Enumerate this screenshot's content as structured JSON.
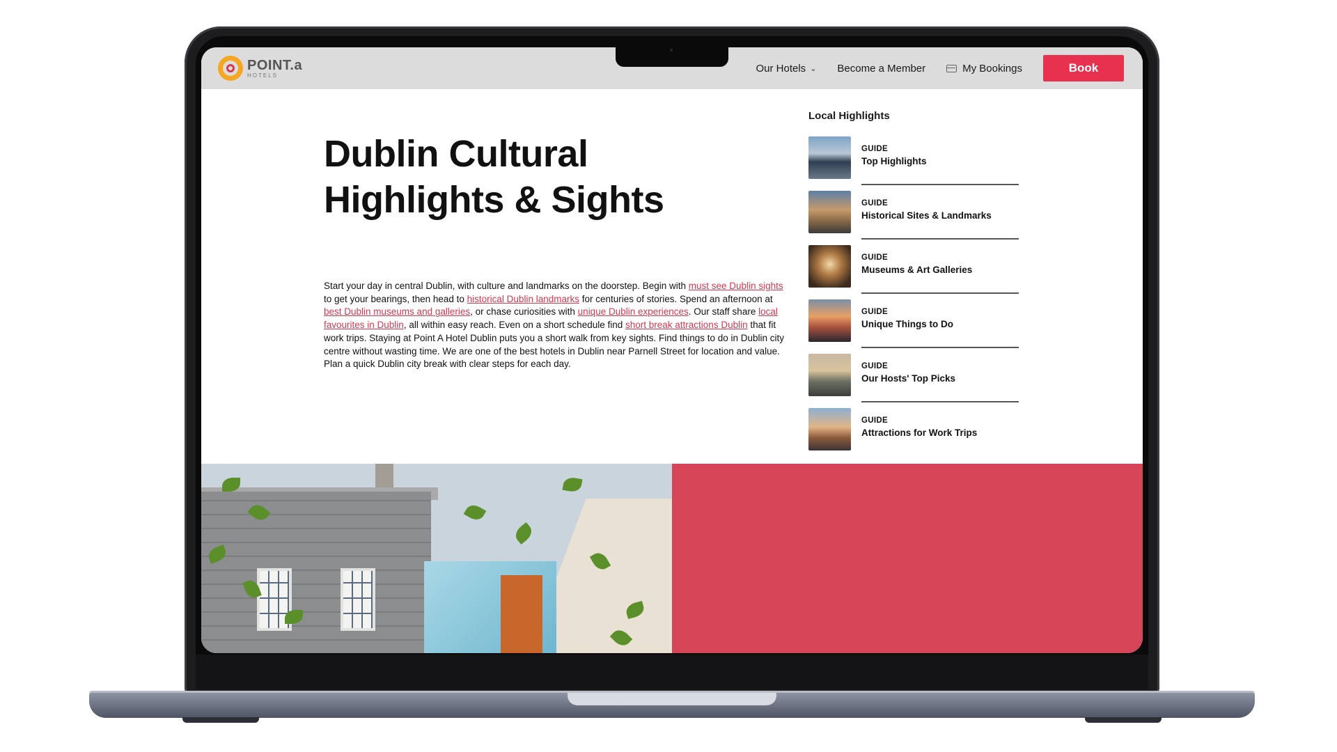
{
  "header": {
    "logo_name": "POINT.a",
    "logo_sub": "HOTELS",
    "nav": {
      "our_hotels": "Our Hotels",
      "become_member": "Become a Member",
      "my_bookings": "My Bookings",
      "book": "Book"
    }
  },
  "main": {
    "headline_line1": "Dublin Cultural",
    "headline_line2": "Highlights & Sights",
    "intro": {
      "p1": "Start your day in central Dublin, with culture and landmarks on the doorstep. Begin with ",
      "link1": "must see Dublin sights",
      "p2": " to get your bearings, then head to ",
      "link2": "historical Dublin landmarks",
      "p3": " for centuries of stories. Spend an afternoon at ",
      "link3": "best Dublin museums and galleries",
      "p4": ", or chase curiosities with ",
      "link4": "unique Dublin experiences",
      "p5": ". Our staff share ",
      "link5": "local favourites in Dublin",
      "p6": ", all within easy reach. Even on a short schedule find ",
      "link6": "short break attractions Dublin",
      "p7": " that fit work trips. Staying at Point A Hotel Dublin puts you a short walk from key sights. Find things to do in Dublin city centre without wasting time. We are one of the best hotels in Dublin near Parnell Street for location and value. Plan a quick Dublin city break with clear steps for each day."
    }
  },
  "highlights": {
    "title": "Local Highlights",
    "items": [
      {
        "kind": "GUIDE",
        "label": "Top Highlights"
      },
      {
        "kind": "GUIDE",
        "label": "Historical Sites & Landmarks"
      },
      {
        "kind": "GUIDE",
        "label": "Museums & Art Galleries"
      },
      {
        "kind": "GUIDE",
        "label": "Unique Things to Do"
      },
      {
        "kind": "GUIDE",
        "label": "Our Hosts' Top Picks"
      },
      {
        "kind": "GUIDE",
        "label": "Attractions for Work Trips"
      }
    ]
  },
  "colors": {
    "accent": "#e8304f",
    "link": "#d6394f",
    "panel": "#d64458",
    "header_bg": "#dcdcdc"
  }
}
